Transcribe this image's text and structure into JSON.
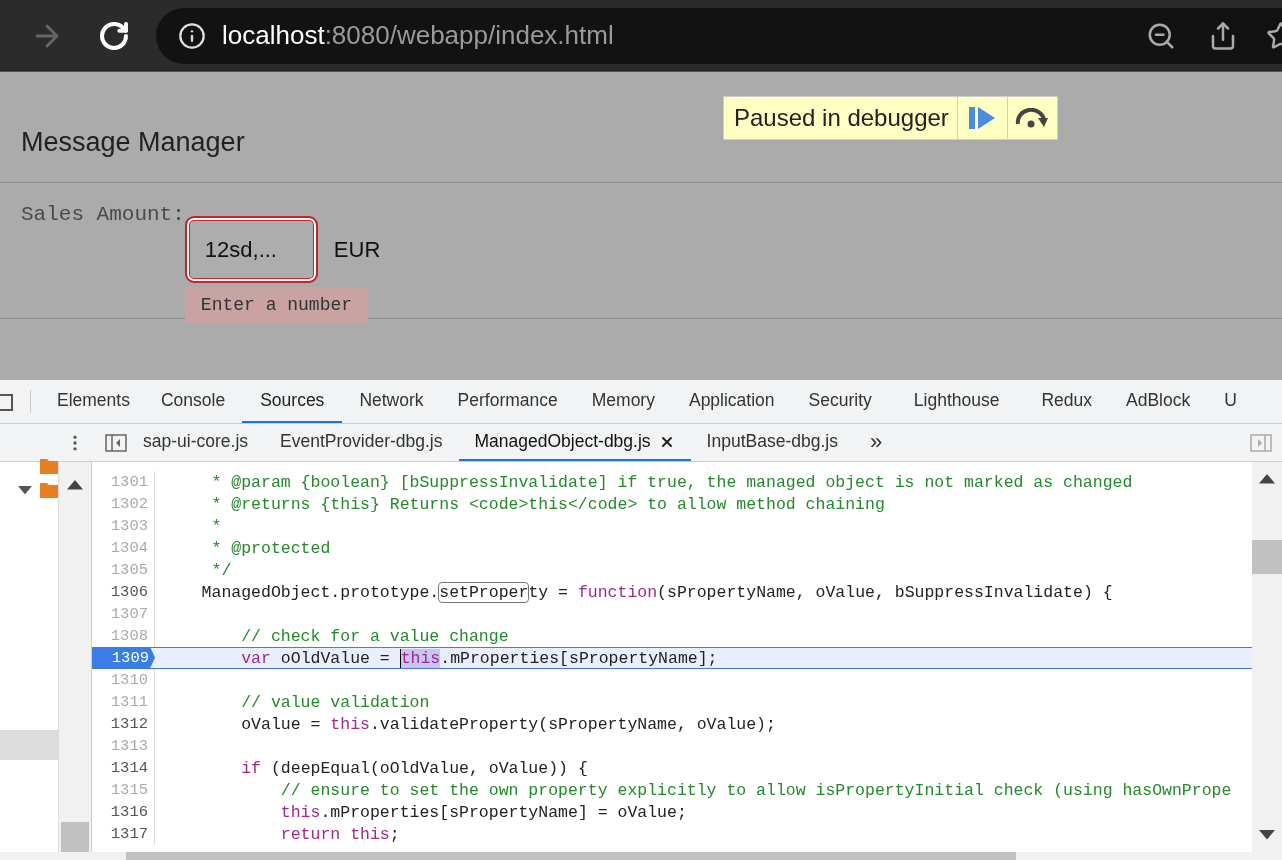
{
  "browser": {
    "forward_disabled": true,
    "url": {
      "host": "localhost",
      "path": ":8080/webapp/index.html"
    }
  },
  "page": {
    "title": "Message Manager",
    "debugger_banner": {
      "text": "Paused in debugger"
    },
    "form": {
      "label": "Sales Amount:",
      "input": {
        "value": "12sd,...",
        "invalid": true
      },
      "unit": "EUR",
      "error": "Enter a number"
    }
  },
  "devtools": {
    "tabs": [
      {
        "label": "Elements",
        "selected": false
      },
      {
        "label": "Console",
        "selected": false
      },
      {
        "label": "Sources",
        "selected": true
      },
      {
        "label": "Network",
        "selected": false
      },
      {
        "label": "Performance",
        "selected": false
      },
      {
        "label": "Memory",
        "selected": false
      },
      {
        "label": "Application",
        "selected": false
      },
      {
        "label": "Security",
        "selected": false
      },
      {
        "label": "Lighthouse",
        "selected": false
      },
      {
        "label": "Redux",
        "selected": false
      },
      {
        "label": "AdBlock",
        "selected": false
      },
      {
        "label": "U",
        "selected": false
      }
    ],
    "files": [
      {
        "label": "sap-ui-core.js",
        "selected": false
      },
      {
        "label": "EventProvider-dbg.js",
        "selected": false
      },
      {
        "label": "ManagedObject-dbg.js",
        "selected": true
      },
      {
        "label": "InputBase-dbg.js",
        "selected": false
      }
    ],
    "more": "»",
    "lines": [
      {
        "number": "1301",
        "breakable": false,
        "current": false,
        "segments": [
          {
            "kind": "comment",
            "text": "     * @param {boolean} [bSuppressInvalidate] if true, the managed object is not marked as changed"
          }
        ]
      },
      {
        "number": "1302",
        "breakable": false,
        "current": false,
        "segments": [
          {
            "kind": "comment",
            "text": "     * @returns {this} Returns <code>this</code> to allow method chaining"
          }
        ]
      },
      {
        "number": "1303",
        "breakable": false,
        "current": false,
        "segments": [
          {
            "kind": "comment",
            "text": "     *"
          }
        ]
      },
      {
        "number": "1304",
        "breakable": false,
        "current": false,
        "segments": [
          {
            "kind": "comment",
            "text": "     * @protected"
          }
        ]
      },
      {
        "number": "1305",
        "breakable": false,
        "current": false,
        "segments": [
          {
            "kind": "comment",
            "text": "     */"
          }
        ]
      },
      {
        "number": "1306",
        "breakable": true,
        "current": false,
        "segments": [
          {
            "kind": "plain",
            "text": "    ManagedObject.prototype."
          },
          {
            "kind": "match",
            "text": "setProper"
          },
          {
            "kind": "plain",
            "text": "ty = "
          },
          {
            "kind": "keyword",
            "text": "function"
          },
          {
            "kind": "plain",
            "text": "(sPropertyName, oValue, bSuppressInvalidate) {"
          }
        ]
      },
      {
        "number": "1307",
        "breakable": false,
        "current": false
      },
      {
        "number": "1308",
        "breakable": false,
        "current": false,
        "segments": [
          {
            "kind": "comment",
            "text": "        // check for a value change"
          }
        ]
      },
      {
        "number": "1309",
        "breakable": true,
        "current": true,
        "segments": [
          {
            "kind": "keyword",
            "text": "        var"
          },
          {
            "kind": "plain",
            "text": " oOldValue = "
          },
          {
            "kind": "selection",
            "text": "this"
          },
          {
            "kind": "plain",
            "text": ".mProperties[sPropertyName];"
          }
        ]
      },
      {
        "number": "1310",
        "breakable": false,
        "current": false
      },
      {
        "number": "1311",
        "breakable": false,
        "current": false,
        "segments": [
          {
            "kind": "comment",
            "text": "        // value validation"
          }
        ]
      },
      {
        "number": "1312",
        "breakable": true,
        "current": false,
        "segments": [
          {
            "kind": "plain",
            "text": "        oValue = "
          },
          {
            "kind": "keyword",
            "text": "this"
          },
          {
            "kind": "plain",
            "text": ".validateProperty(sPropertyName, oValue);"
          }
        ]
      },
      {
        "number": "1313",
        "breakable": false,
        "current": false
      },
      {
        "number": "1314",
        "breakable": true,
        "current": false,
        "segments": [
          {
            "kind": "keyword",
            "text": "        if"
          },
          {
            "kind": "plain",
            "text": " (deepEqual(oOldValue, oValue)) {"
          }
        ]
      },
      {
        "number": "1315",
        "breakable": false,
        "current": false,
        "segments": [
          {
            "kind": "comment",
            "text": "            // ensure to set the own property explicitly to allow isPropertyInitial check (using hasOwnPrope"
          }
        ]
      },
      {
        "number": "1316",
        "breakable": true,
        "current": false,
        "segments": [
          {
            "kind": "keyword",
            "text": "            this"
          },
          {
            "kind": "plain",
            "text": ".mProperties[sPropertyName] = oValue;"
          }
        ]
      },
      {
        "number": "1317",
        "breakable": true,
        "current": false,
        "segments": [
          {
            "kind": "keyword",
            "text": "            return this"
          },
          {
            "kind": "plain",
            "text": ";"
          }
        ]
      }
    ]
  }
}
